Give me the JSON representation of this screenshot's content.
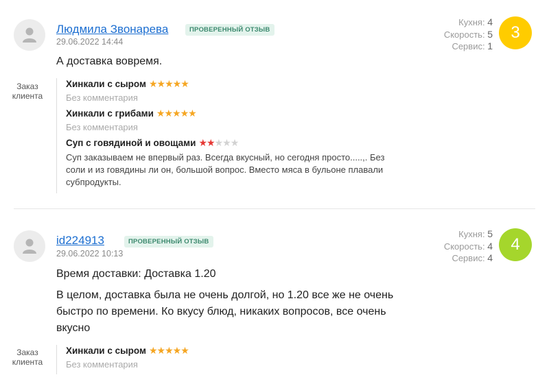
{
  "reviews": [
    {
      "author": "Людмила Звонарева",
      "badge": "ПРОВЕРЕННЫЙ ОТЗЫВ",
      "date": "29.06.2022 14:44",
      "ratings": {
        "kitchen_label": "Кухня:",
        "kitchen": "4",
        "speed_label": "Скорость:",
        "speed": "5",
        "service_label": "Сервис:",
        "service": "1"
      },
      "score": "3",
      "score_color": "#ffcc00",
      "text": [
        "А доставка вовремя."
      ],
      "order_label": "Заказ клиента",
      "order": [
        {
          "name": "Хинкали с сыром",
          "stars": 5,
          "comment": "Без комментария",
          "commented": false
        },
        {
          "name": "Хинкали с грибами",
          "stars": 5,
          "comment": "Без комментария",
          "commented": false
        },
        {
          "name": "Суп с говядиной и овощами",
          "stars": 2,
          "comment": "Суп заказываем не впервый раз. Всегда вкусный, но сегодня просто.....,. Без соли и из говядины ли он, большой вопрос. Вместо мяса в бульоне плавали субпродукты.",
          "commented": true
        }
      ]
    },
    {
      "author": "id224913",
      "badge": "ПРОВЕРЕННЫЙ ОТЗЫВ",
      "date": "29.06.2022 10:13",
      "ratings": {
        "kitchen_label": "Кухня:",
        "kitchen": "5",
        "speed_label": "Скорость:",
        "speed": "4",
        "service_label": "Сервис:",
        "service": "4"
      },
      "score": "4",
      "score_color": "#a5d62c",
      "text": [
        "Время доставки: Доставка 1.20",
        "В целом, доставка была не очень долгой, но 1.20 все же не очень быстро по времени. Ко вкусу блюд, никаких вопросов, все очень вкусно"
      ],
      "order_label": "Заказ клиента",
      "order": [
        {
          "name": "Хинкали с сыром",
          "stars": 5,
          "comment": "Без комментария",
          "commented": false
        }
      ]
    }
  ]
}
